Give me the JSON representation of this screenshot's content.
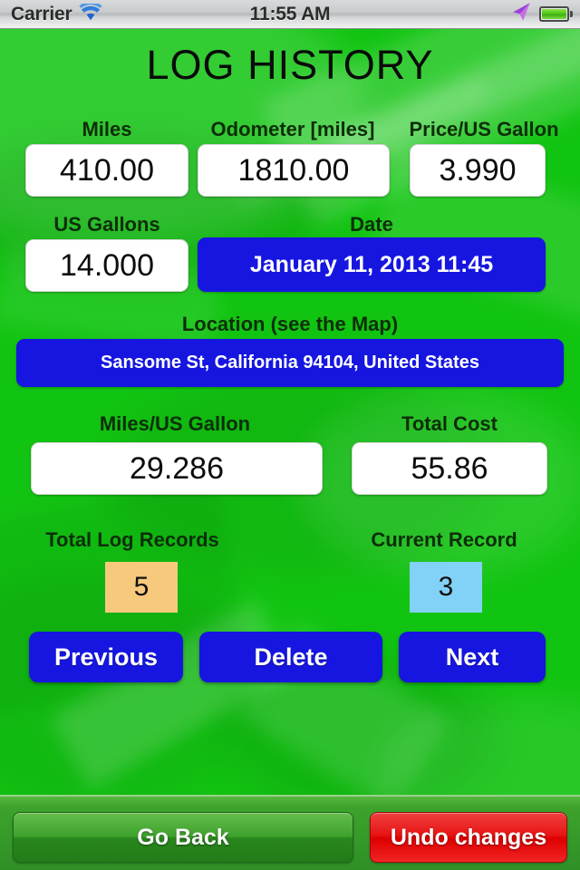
{
  "status_bar": {
    "carrier": "Carrier",
    "time": "11:55 AM",
    "wifi_icon": "wifi-icon",
    "location_icon": "location-arrow-icon",
    "battery_icon": "battery-icon"
  },
  "header": {
    "title": "LOG HISTORY"
  },
  "fields": {
    "miles": {
      "label": "Miles",
      "value": "410.00"
    },
    "odometer": {
      "label": "Odometer [miles]",
      "value": "1810.00"
    },
    "price_per_gallon": {
      "label": "Price/US Gallon",
      "value": "3.990"
    },
    "us_gallons": {
      "label": "US Gallons",
      "value": "14.000"
    },
    "date": {
      "label": "Date",
      "value": "January 11, 2013 11:45"
    },
    "location": {
      "label": "Location (see the Map)",
      "value": "Sansome St, California 94104, United States"
    },
    "miles_per_gallon": {
      "label": "Miles/US Gallon",
      "value": "29.286"
    },
    "total_cost": {
      "label": "Total Cost",
      "value": "55.86"
    },
    "total_log_records": {
      "label": "Total Log Records",
      "value": "5"
    },
    "current_record": {
      "label": "Current Record",
      "value": "3"
    }
  },
  "nav_buttons": {
    "previous": "Previous",
    "delete": "Delete",
    "next": "Next"
  },
  "toolbar": {
    "go_back": "Go Back",
    "undo_changes": "Undo changes"
  },
  "colors": {
    "background_green": "#12c412",
    "field_blue": "#1616e0",
    "count_orange": "#f7c97d",
    "count_blue": "#82d1f6",
    "toolbar_green": "#3da32b",
    "undo_red": "#e81414",
    "label_text": "#0d2e08"
  }
}
